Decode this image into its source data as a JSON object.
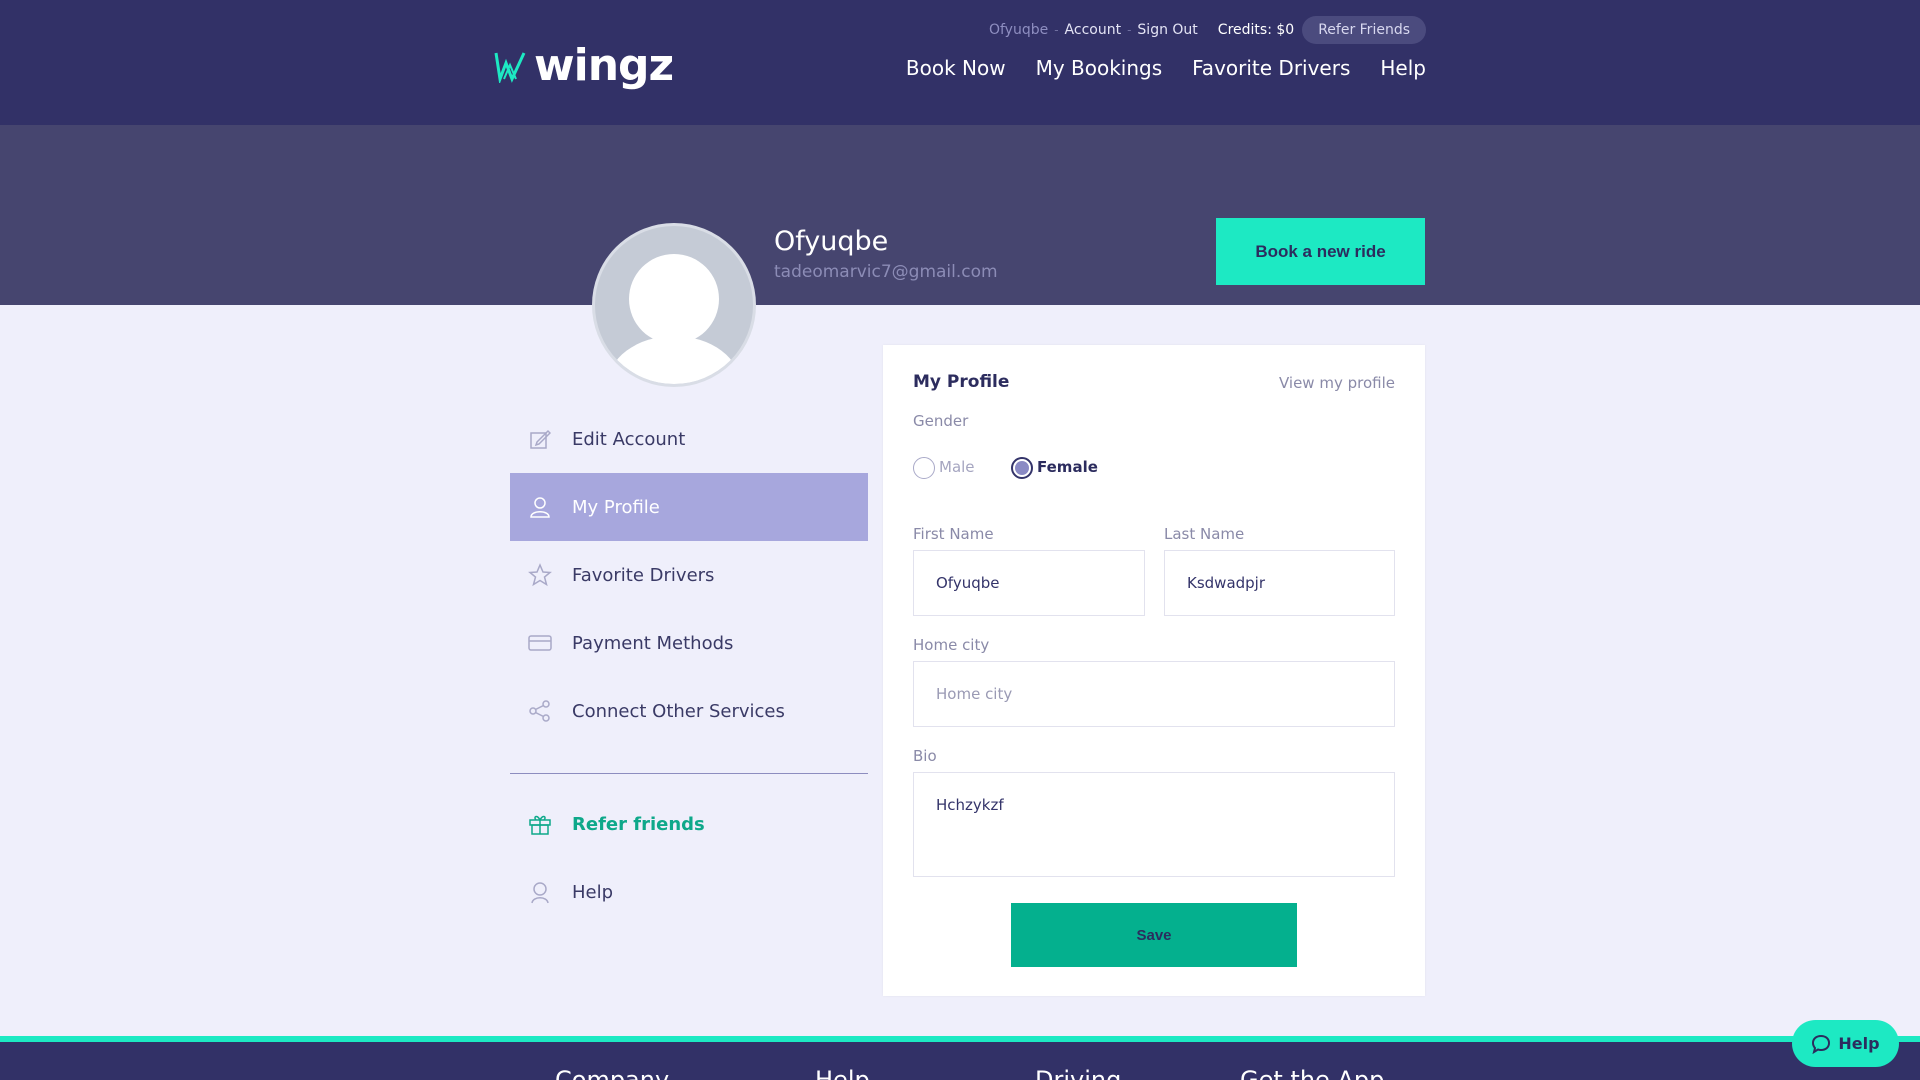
{
  "header": {
    "logo_text": "wingz",
    "utility": {
      "username": "Ofyuqbe",
      "account": "Account",
      "sign_out": "Sign Out",
      "credits": "Credits: $0",
      "refer_friends": "Refer Friends"
    },
    "nav": [
      "Book Now",
      "My Bookings",
      "Favorite Drivers",
      "Help"
    ]
  },
  "profile_banner": {
    "name": "Ofyuqbe",
    "email": "tadeomarvic7@gmail.com",
    "book_button": "Book a new ride"
  },
  "sidebar": {
    "items": [
      {
        "label": "Edit Account",
        "icon": "edit-icon"
      },
      {
        "label": "My Profile",
        "icon": "user-icon",
        "active": true
      },
      {
        "label": "Favorite Drivers",
        "icon": "star-icon"
      },
      {
        "label": "Payment Methods",
        "icon": "card-icon"
      },
      {
        "label": "Connect Other Services",
        "icon": "share-icon"
      }
    ],
    "extra": [
      {
        "label": "Refer friends",
        "icon": "gift-icon"
      },
      {
        "label": "Help",
        "icon": "help-person-icon"
      }
    ]
  },
  "form": {
    "title": "My Profile",
    "view_link": "View my profile",
    "gender_label": "Gender",
    "gender_options": [
      "Male",
      "Female"
    ],
    "gender_selected": "Female",
    "first_name_label": "First Name",
    "first_name_value": "Ofyuqbe",
    "last_name_label": "Last Name",
    "last_name_value": "Ksdwadpjr",
    "home_city_label": "Home city",
    "home_city_placeholder": "Home city",
    "bio_label": "Bio",
    "bio_value": "Hchzykzf",
    "save_button": "Save"
  },
  "footer": {
    "headings": [
      "Company",
      "Help",
      "Driving",
      "Get the App"
    ]
  },
  "help_widget": {
    "label": "Help"
  },
  "colors": {
    "header_bg": "#323167",
    "banner_bg": "#46456f",
    "accent_teal": "#1de9c3",
    "save_green": "#04b08e",
    "active_sidebar": "#a7a7dd",
    "page_bg": "#efeffb"
  }
}
